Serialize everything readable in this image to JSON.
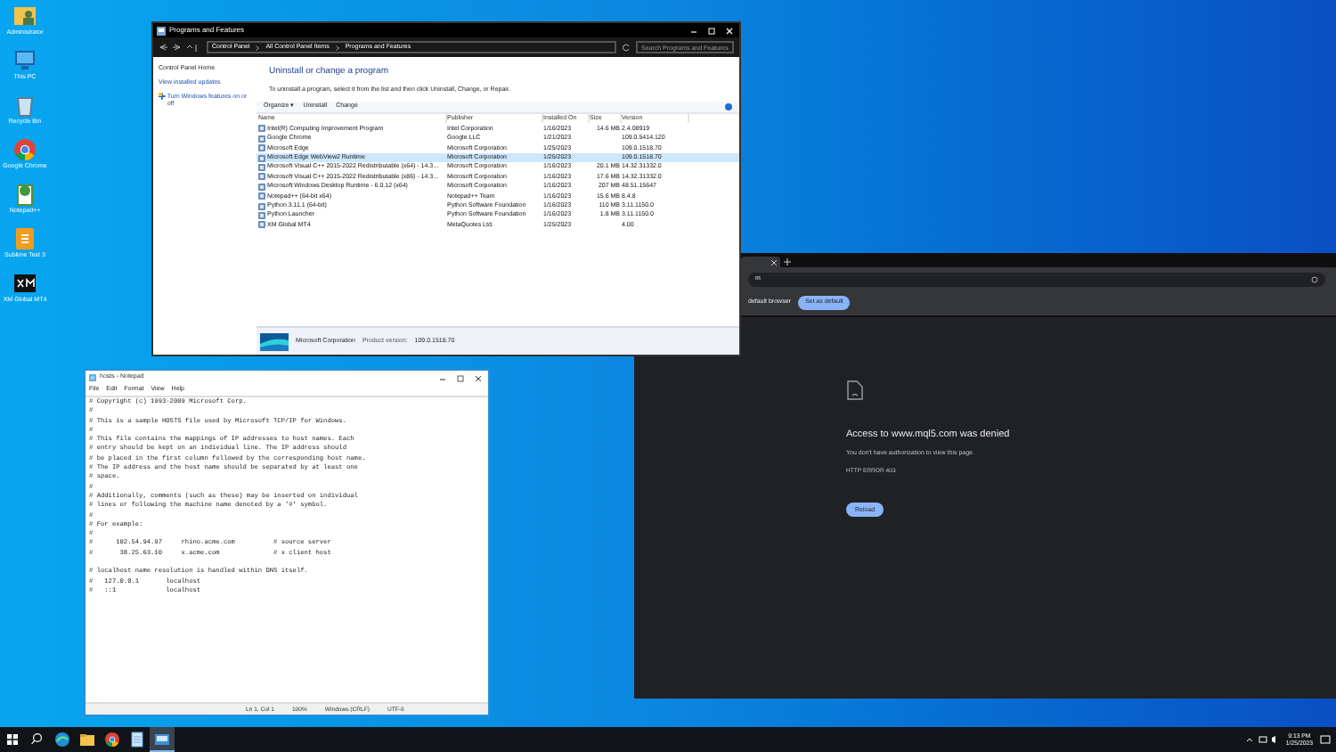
{
  "desktop_icons": [
    {
      "kind": "user",
      "label": "Administrator"
    },
    {
      "kind": "pc",
      "label": "This PC"
    },
    {
      "kind": "bin",
      "label": "Recycle Bin"
    },
    {
      "kind": "chrome",
      "label": "Google Chrome"
    },
    {
      "kind": "npp",
      "label": "Notepad++"
    },
    {
      "kind": "sublime",
      "label": "Sublime Text 3"
    },
    {
      "kind": "xm",
      "label": "XM Global MT4"
    }
  ],
  "control_panel": {
    "title": "Programs and Features",
    "breadcrumb": [
      "Control Panel",
      "All Control Panel Items",
      "Programs and Features"
    ],
    "search": {
      "placeholder": "Search Programs and Features"
    },
    "sidebar": [
      "Control Panel Home",
      "View installed updates",
      "Turn Windows features on or off"
    ],
    "heading": "Uninstall or change a program",
    "instructions": "To uninstall a program, select it from the list and then click Uninstall, Change, or Repair.",
    "toolbar": [
      "Organize ▾",
      "Uninstall",
      "Change"
    ],
    "columns": [
      "Name",
      "Publisher",
      "Installed On",
      "Size",
      "Version"
    ],
    "rows": [
      {
        "name": "Intel(R) Computing Improvement Program",
        "publisher": "Intel Corporation",
        "installed_on": "1/16/2023",
        "size": "14.6 MB",
        "version": "2.4.08919",
        "selected": false
      },
      {
        "name": "Google Chrome",
        "publisher": "Google LLC",
        "installed_on": "1/21/2023",
        "version": "109.0.5414.120",
        "selected": false
      },
      {
        "name": "Microsoft Edge",
        "publisher": "Microsoft Corporation",
        "installed_on": "1/25/2023",
        "version": "109.0.1518.70",
        "selected": false
      },
      {
        "name": "Microsoft Edge WebView2 Runtime",
        "publisher": "Microsoft Corporation",
        "installed_on": "1/25/2023",
        "version": "109.0.1518.70",
        "selected": true
      },
      {
        "name": "Microsoft Visual C++ 2015-2022 Redistributable (x64) - 14.3...",
        "publisher": "Microsoft Corporation",
        "installed_on": "1/16/2023",
        "size": "20.1 MB",
        "version": "14.32.31332.0",
        "selected": false
      },
      {
        "name": "Microsoft Visual C++ 2015-2022 Redistributable (x86) - 14.3...",
        "publisher": "Microsoft Corporation",
        "installed_on": "1/16/2023",
        "size": "17.6 MB",
        "version": "14.32.31332.0",
        "selected": false
      },
      {
        "name": "Microsoft Windows Desktop Runtime - 6.0.12 (x64)",
        "publisher": "Microsoft Corporation",
        "installed_on": "1/16/2023",
        "size": "207 MB",
        "version": "48.51.15647",
        "selected": false
      },
      {
        "name": "Notepad++ (64-bit x64)",
        "publisher": "Notepad++ Team",
        "installed_on": "1/16/2023",
        "size": "15.6 MB",
        "version": "8.4.8",
        "selected": false
      },
      {
        "name": "Python 3.11.1 (64-bit)",
        "publisher": "Python Software Foundation",
        "installed_on": "1/16/2023",
        "size": "110 MB",
        "version": "3.11.1150.0",
        "selected": false
      },
      {
        "name": "Python Launcher",
        "publisher": "Python Software Foundation",
        "installed_on": "1/16/2023",
        "size": "1.8 MB",
        "version": "3.11.1150.0",
        "selected": false
      },
      {
        "name": "XM Global MT4",
        "publisher": "MetaQuotes Ltd.",
        "installed_on": "1/25/2023",
        "version": "4.00",
        "selected": false
      }
    ],
    "details": {
      "publisher": "Microsoft Corporation",
      "version_label": "Product version:",
      "version": "109.0.1518.70"
    }
  },
  "notepad": {
    "title": "hosts - Notepad",
    "menu": [
      "File",
      "Edit",
      "Format",
      "View",
      "Help"
    ],
    "paragraphs": [
      [
        "# Copyright (c) 1993-2009 Microsoft Corp.",
        "#",
        "# This is a sample HOSTS file used by Microsoft TCP/IP for Windows.",
        "#",
        "# This file contains the mappings of IP addresses to host names. Each",
        "# entry should be kept on an individual line. The IP address should",
        "# be placed in the first column followed by the corresponding host name.",
        "# The IP address and the host name should be separated by at least one",
        "# space.",
        "#",
        "# Additionally, comments (such as these) may be inserted on individual",
        "# lines or following the machine name denoted by a '#' symbol.",
        "#",
        "# For example:",
        "#",
        "#      102.54.94.97     rhino.acme.com          # source server",
        "#       38.25.63.10     x.acme.com              # x client host"
      ],
      [
        "# localhost name resolution is handled within DNS itself.",
        "#\t127.0.0.1       localhost",
        "#\t::1             localhost"
      ]
    ],
    "status": [
      "Ln 1, Col 1",
      "100%",
      "Windows (CRLF)",
      "UTF-8"
    ]
  },
  "browser": {
    "address": "m",
    "infobar": {
      "text": "default browser",
      "button": "Set as default"
    },
    "error": {
      "title": "Access to www.mql5.com was denied",
      "message": "You don't have authorization to view this page.",
      "code": "HTTP ERROR 403",
      "button": "Reload"
    }
  },
  "taskbar": {
    "apps": [
      {
        "kind": "edge",
        "active": false
      },
      {
        "kind": "explorer",
        "active": false
      },
      {
        "kind": "chrome",
        "active": false
      },
      {
        "kind": "notepad",
        "active": false
      },
      {
        "kind": "control",
        "active": true
      }
    ],
    "time": "9:13 PM",
    "date": "1/25/2023"
  }
}
